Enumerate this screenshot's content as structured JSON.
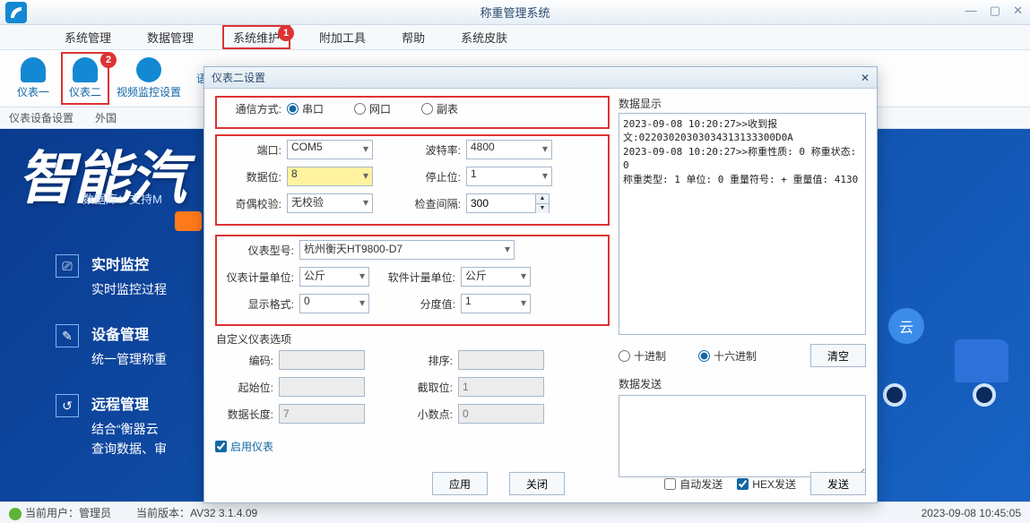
{
  "window": {
    "title": "称重管理系统"
  },
  "menu": {
    "sysadmin": "系统管理",
    "dataadmin": "数据管理",
    "sysmaint": "系统维护",
    "addon": "附加工具",
    "help": "帮助",
    "skin": "系统皮肤"
  },
  "toolbar": {
    "meter1": "仪表一",
    "meter2": "仪表二",
    "video": "视频监控设置",
    "lang": "语"
  },
  "subbar": {
    "dev": "仪表设备设置",
    "fg": "外国"
  },
  "bg": {
    "big": "智能汽",
    "db": "数据库：支持M",
    "f1t": "实时监控",
    "f1d": "实时监控过程",
    "f2t": "设备管理",
    "f2d": "统一管理称重",
    "f3t": "远程管理",
    "f3d1": "结合“衡器云",
    "f3d2": "查询数据、审",
    "cloud": "云"
  },
  "status": {
    "userlbl": "当前用户：",
    "user": "管理员",
    "verlbl": "当前版本：",
    "ver": "AV32 3.1.4.09",
    "time": "2023-09-08 10:45:05"
  },
  "dlg": {
    "title": "仪表二设置",
    "comm_label": "通信方式:",
    "comm_serial": "串口",
    "comm_net": "网口",
    "comm_aux": "副表",
    "port_l": "端口:",
    "port_v": "COM5",
    "baud_l": "波特率:",
    "baud_v": "4800",
    "databit_l": "数据位:",
    "databit_v": "8",
    "stopbit_l": "停止位:",
    "stopbit_v": "1",
    "parity_l": "奇偶校验:",
    "parity_v": "无校验",
    "interval_l": "检查间隔:",
    "interval_v": "300",
    "model_l": "仪表型号:",
    "model_v": "杭州衡天HT9800-D7",
    "munit_l": "仪表计量单位:",
    "munit_v": "公斤",
    "sunit_l": "软件计量单位:",
    "sunit_v": "公斤",
    "dispfmt_l": "显示格式:",
    "dispfmt_v": "0",
    "div_l": "分度值:",
    "div_v": "1",
    "custom_legend": "自定义仪表选项",
    "code_l": "编码:",
    "sort_l": "排序:",
    "start_l": "起始位:",
    "cut_l": "截取位:",
    "cut_v": "1",
    "len_l": "数据长度:",
    "len_v": "7",
    "dec_l": "小数点:",
    "dec_v": "0",
    "enable": "启用仪表",
    "apply": "应用",
    "close": "关闭",
    "log_label": "数据显示",
    "log": "2023-09-08 10:20:27>>收到报\n文:02203020303034313133300D0A\n2023-09-08 10:20:27>>称重性质: 0 称重状态: 0 \n称重类型: 1 单位: 0 重量符号: + 重量值: 4130",
    "dec_radix": "十进制",
    "hex_radix": "十六进制",
    "clear": "清空",
    "send_label": "数据发送",
    "autosend": "自动发送",
    "hexsend": "HEX发送",
    "send": "发送"
  },
  "badges": {
    "b1": "1",
    "b2": "2"
  }
}
